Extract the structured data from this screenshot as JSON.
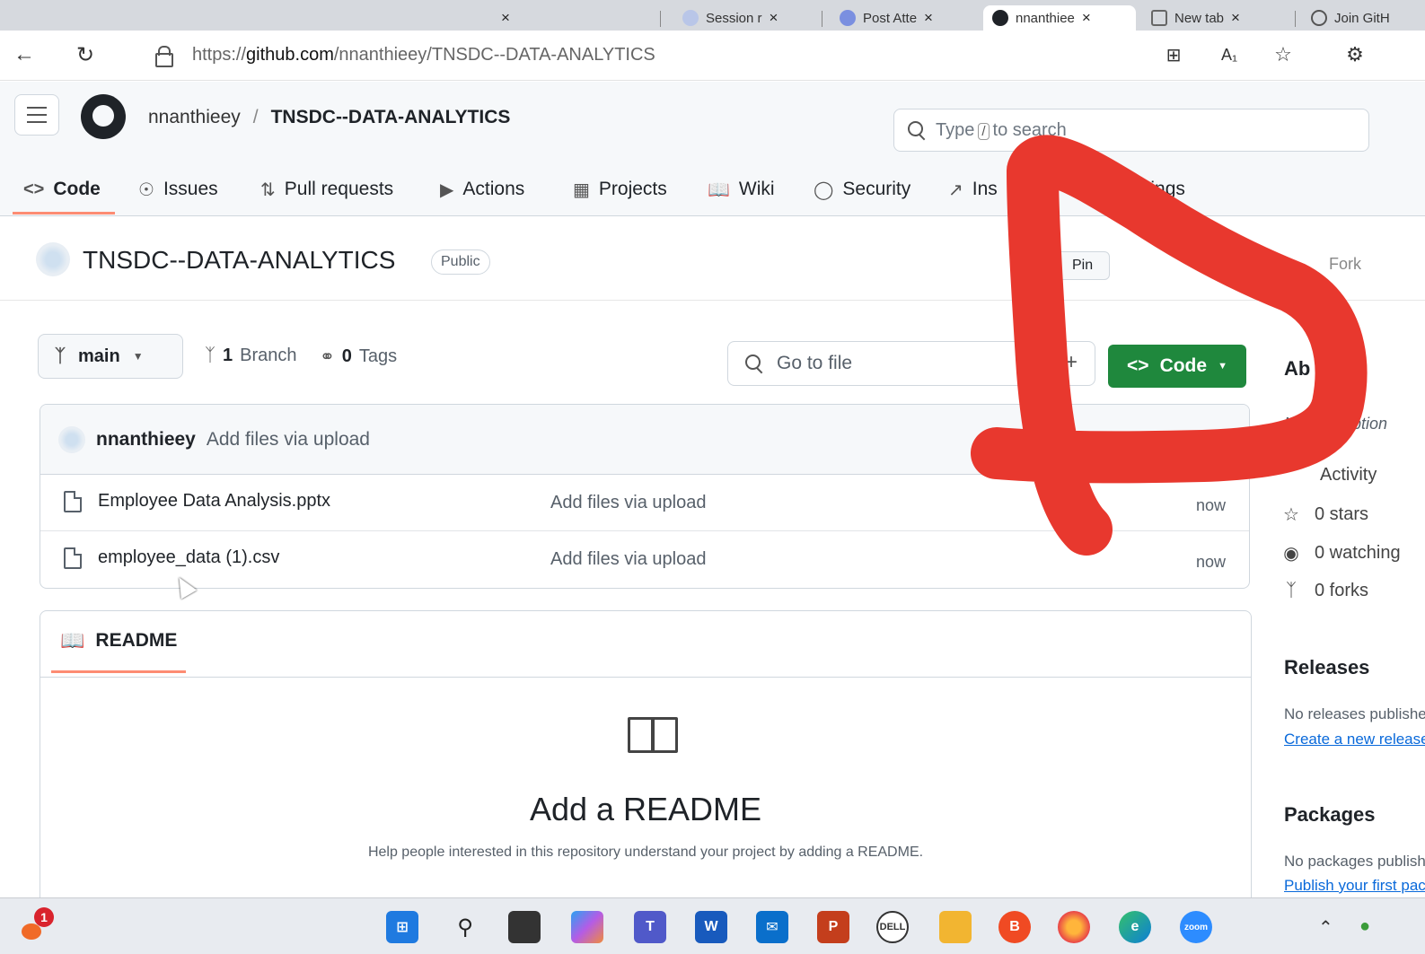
{
  "browser": {
    "tabs": [
      {
        "title": "",
        "active": false
      },
      {
        "title": "",
        "active": false
      },
      {
        "title": "Session r",
        "active": false
      },
      {
        "title": "Post Atte",
        "active": false
      },
      {
        "title": "nnanthiee",
        "active": true
      },
      {
        "title": "New tab",
        "active": false
      },
      {
        "title": "Join GitH",
        "active": false
      }
    ],
    "close_glyph": "×",
    "url_prefix": "https://",
    "url_host": "github.com",
    "url_path": "/nnanthieey/TNSDC--DATA-ANALYTICS"
  },
  "header": {
    "owner": "nnanthieey",
    "separator": "/",
    "repo": "TNSDC--DATA-ANALYTICS",
    "search_placeholder_pre": "Type",
    "search_key": "/",
    "search_placeholder_post": "to search"
  },
  "repo_nav": {
    "code": "Code",
    "issues": "Issues",
    "pull_requests": "Pull requests",
    "actions": "Actions",
    "projects": "Projects",
    "wiki": "Wiki",
    "security": "Security",
    "insights": "Ins",
    "settings": "Settings"
  },
  "repo": {
    "name": "TNSDC--DATA-ANALYTICS",
    "visibility": "Public",
    "pin": "Pin",
    "fork": "Fork"
  },
  "file_browser": {
    "branch": "main",
    "branch_count": "1",
    "branch_label": "Branch",
    "tag_count": "0",
    "tag_label": "Tags",
    "goto_placeholder": "Go to file",
    "add_glyph": "+",
    "code_button": "Code",
    "latest_commit": {
      "author": "nnanthieey",
      "message": "Add files via upload"
    },
    "files": [
      {
        "name": "Employee Data Analysis.pptx",
        "commit": "Add files via upload",
        "age": "now"
      },
      {
        "name": "employee_data (1).csv",
        "commit": "Add files via upload",
        "age": "now"
      }
    ]
  },
  "readme": {
    "tab_label": "README",
    "heading": "Add a README",
    "help": "Help people interested in this repository understand your project by adding a README."
  },
  "sidebar": {
    "about_heading": "Ab",
    "description": "No description",
    "activity": "Activity",
    "stars": "0 stars",
    "watching": "0 watching",
    "forks": "0 forks",
    "releases_heading": "Releases",
    "releases_text": "No releases published",
    "releases_link": "Create a new release",
    "packages_heading": "Packages",
    "packages_text": "No packages published",
    "packages_link": "Publish your first package"
  },
  "taskbar": {
    "notification_count": "1",
    "apps": [
      "start",
      "search",
      "task-view",
      "copilot",
      "teams",
      "word",
      "mail",
      "powerpoint",
      "dell",
      "file-explorer",
      "brave",
      "firefox",
      "edge",
      "zoom"
    ]
  },
  "colors": {
    "accent_green": "#1f883d",
    "tab_underline": "#fd8c73",
    "annotation_red": "#e8382e"
  }
}
